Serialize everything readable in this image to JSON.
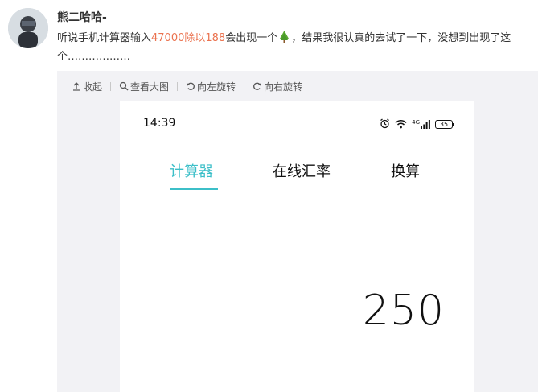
{
  "post": {
    "username": "熊二哈哈-",
    "text_before": "听说手机计算器输入",
    "text_highlight": "47000除以188",
    "text_middle": "会出现一个",
    "text_after": "，结果我很认真的去试了一下，没想到出现了这个………………"
  },
  "toolbar": {
    "collapse": "收起",
    "view_large": "查看大图",
    "rotate_left": "向左旋转",
    "rotate_right": "向右旋转"
  },
  "phone": {
    "time": "14:39",
    "network": "4G",
    "battery": "35",
    "tabs": [
      "计算器",
      "在线汇率",
      "换算"
    ],
    "active_tab": "计算器",
    "result": "250"
  },
  "colors": {
    "highlight": "#eb7350",
    "accent": "#3cbfc8"
  },
  "icons": [
    "avatar",
    "tree-emoji-icon",
    "collapse-icon",
    "search-icon",
    "rotate-left-icon",
    "rotate-right-icon",
    "alarm-icon",
    "wifi-icon",
    "signal-icon",
    "battery-icon"
  ]
}
